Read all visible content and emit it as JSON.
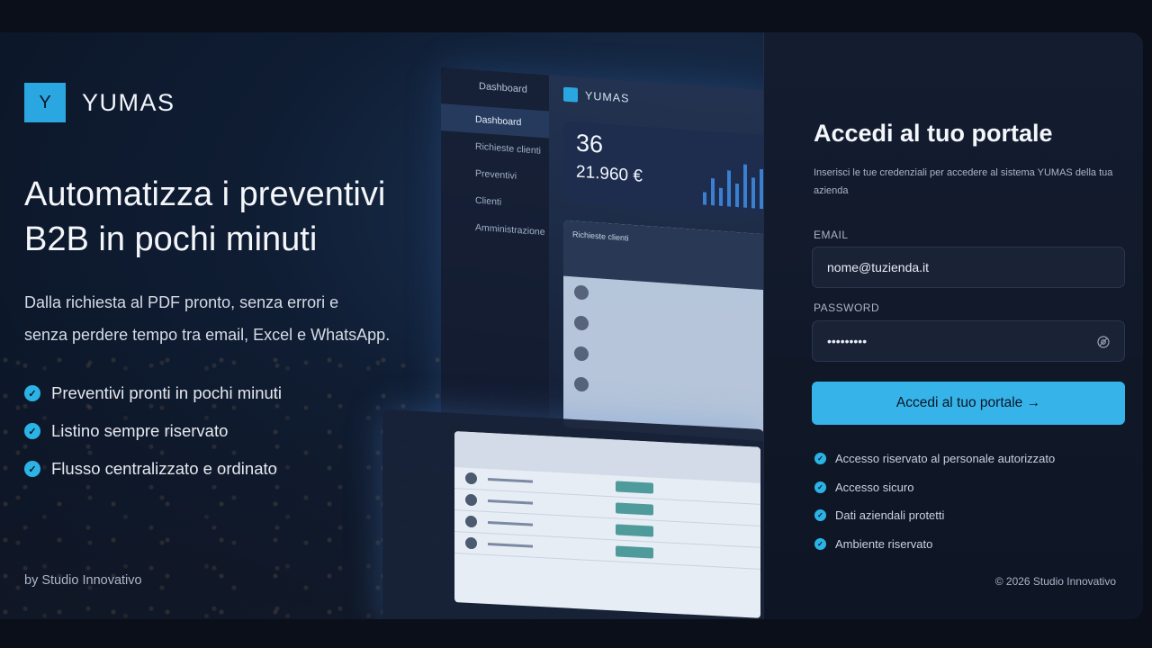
{
  "brand": {
    "logo_letter": "Y",
    "name": "YUMAS"
  },
  "hero": {
    "headline_line1": "Automatizza i preventivi",
    "headline_line2": "B2B in pochi minuti",
    "subhead_line1": "Dalla richiesta al PDF pronto, senza errori e",
    "subhead_line2": "senza perdere tempo tra email, Excel e WhatsApp.",
    "features": [
      "Preventivi pronti in pochi minuti",
      "Listino sempre riservato",
      "Flusso centralizzato e ordinato"
    ],
    "byline": "by Studio Innovativo"
  },
  "mock": {
    "sidebar": [
      "Dashboard",
      "Richieste clienti",
      "Preventivi",
      "Clienti",
      "Amministrazione"
    ],
    "title": "Dashboard",
    "app_name": "YUMAS",
    "stat_big": "36",
    "stat_money": "21.960 €",
    "table_title": "Richieste clienti"
  },
  "login": {
    "title": "Accedi al tuo portale",
    "description": "Inserisci le tue credenziali per accedere al sistema YUMAS della tua azienda",
    "email_label": "EMAIL",
    "email_value": "nome@tuzienda.it",
    "password_label": "PASSWORD",
    "password_value": "•••••••••",
    "submit_label": "Accedi al tuo portale →",
    "badges": [
      "Accesso riservato al personale autorizzato",
      "Accesso sicuro",
      "Dati aziendali protetti",
      "Ambiente riservato"
    ],
    "copyright": "© 2026 Studio Innovativo"
  },
  "colors": {
    "accent": "#36b4ea",
    "background": "#0b0f1a",
    "panel": "#141d30"
  }
}
